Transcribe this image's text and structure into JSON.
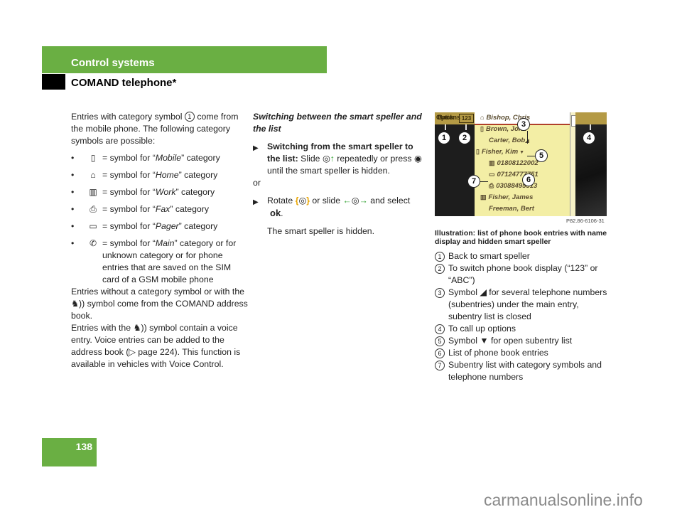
{
  "header": {
    "section": "Control systems",
    "subsection": "COMAND telephone*"
  },
  "col1": {
    "intro_before": "Entries with category symbol",
    "intro_ref": "1",
    "intro_after": "come from the mobile phone. The following category symbols are possible:",
    "categories": [
      {
        "icon": "mobile-icon",
        "glyph": "▯",
        "prefix": "= symbol for “",
        "name": "Mobile",
        "suffix": "” category"
      },
      {
        "icon": "home-icon",
        "glyph": "⌂",
        "prefix": "= symbol for “",
        "name": "Home",
        "suffix": "” category"
      },
      {
        "icon": "work-icon",
        "glyph": "▥",
        "prefix": "= symbol for “",
        "name": "Work",
        "suffix": "” category"
      },
      {
        "icon": "fax-icon",
        "glyph": "⎙",
        "prefix": "= symbol for “",
        "name": "Fax",
        "suffix": "” category"
      },
      {
        "icon": "pager-icon",
        "glyph": "▭",
        "prefix": "= symbol for “",
        "name": "Pager",
        "suffix": "” category"
      },
      {
        "icon": "phone-handset-icon",
        "glyph": "✆",
        "prefix": "= symbol for “",
        "name": "Main",
        "suffix": "” category or for unknown category or for phone entries that are saved on the SIM card of a GSM mobile phone"
      }
    ],
    "para2_a": "Entries without a category symbol or with the",
    "para2_b": "symbol come from the COMAND address book.",
    "para3_a": "Entries with the",
    "para3_b": "symbol contain a voice entry. Voice entries can be added to the address book (",
    "page_ref": "▷ page 224",
    "para3_c": "). This function is available in vehicles with Voice Control."
  },
  "col2": {
    "heading": "Switching between the smart speller and the list",
    "step1_bold": "Switching from the smart speller to the list:",
    "step1_a": "Slide",
    "step1_b": "repeatedly or press",
    "step1_c": "until the smart speller is hidden.",
    "or": "or",
    "step2_a": "Rotate",
    "step2_b": "or slide",
    "step2_c": "and select",
    "ok": "ok",
    "step2_end": ".",
    "result": "The smart speller is hidden."
  },
  "illustration": {
    "back_label": "Back",
    "toggle_label": "123",
    "options_label": "Options",
    "rows": [
      {
        "icon": "home-icon",
        "glyph": "⌂",
        "text": "Bishop, Chris"
      },
      {
        "icon": "mobile-icon",
        "glyph": "▯",
        "text": "Brown, John"
      },
      {
        "icon": "",
        "glyph": "",
        "text": "Carter, Bob"
      },
      {
        "icon": "mobile-icon",
        "glyph": "▯",
        "text": "Fisher, Kim"
      },
      {
        "icon": "work-icon",
        "glyph": "▥",
        "text": "01808122002"
      },
      {
        "icon": "pager-icon",
        "glyph": "▭",
        "text": "07124777751"
      },
      {
        "icon": "fax-icon",
        "glyph": "⎙",
        "text": "03088495313"
      },
      {
        "icon": "work-icon",
        "glyph": "▥",
        "text": "Fisher, James"
      },
      {
        "icon": "",
        "glyph": "",
        "text": "Freeman, Bert"
      }
    ],
    "callouts": [
      "1",
      "2",
      "3",
      "4",
      "5",
      "6",
      "7"
    ],
    "reference": "P82.86-6106-31"
  },
  "col3": {
    "caption": "Illustration: list of phone book entries with name display and hidden smart speller",
    "legend": [
      {
        "n": "1",
        "text": "Back to smart speller"
      },
      {
        "n": "2",
        "text": "To switch phone book display (“123” or “ABC”)"
      },
      {
        "n": "3",
        "text": "Symbol ◢ for several telephone numbers (subentries) under the main entry, subentry list is closed"
      },
      {
        "n": "4",
        "text": "To call up options"
      },
      {
        "n": "5",
        "text": "Symbol ▼ for open subentry list"
      },
      {
        "n": "6",
        "text": "List of phone book entries"
      },
      {
        "n": "7",
        "text": "Subentry list with category symbols and telephone numbers"
      }
    ]
  },
  "footer": {
    "page_number": "138",
    "watermark": "carmanualsonline.info"
  }
}
